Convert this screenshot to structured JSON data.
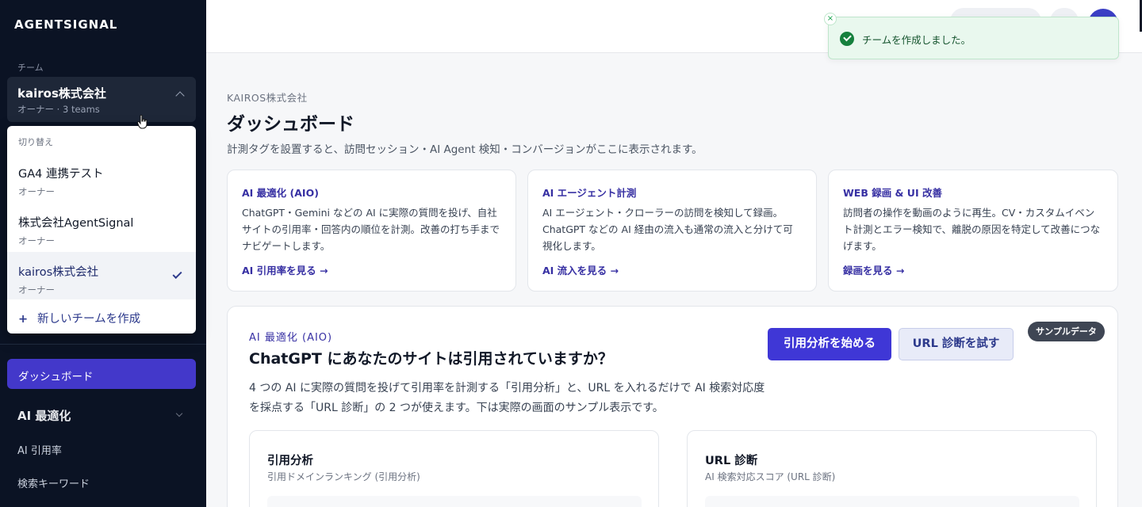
{
  "sidebar": {
    "brand": "AGENTSIGNAL",
    "team_section_label": "チーム",
    "current_team": {
      "name": "kairos株式会社",
      "meta": "オーナー · 3 teams"
    },
    "dropdown": {
      "header": "切り替え",
      "items": [
        {
          "name": "GA4 連携テスト",
          "role": "オーナー",
          "active": false
        },
        {
          "name": "株式会社AgentSignal",
          "role": "オーナー",
          "active": false
        },
        {
          "name": "kairos株式会社",
          "role": "オーナー",
          "active": true
        }
      ],
      "create_plus": "+",
      "create_label": "新しいチームを作成"
    },
    "nav": {
      "dashboard": "ダッシュボード",
      "group": "AI 最適化",
      "sub_items": [
        "AI 引用率",
        "検索キーワード"
      ]
    }
  },
  "toast": {
    "close": "×",
    "message": "チームを作成しました。"
  },
  "main": {
    "breadcrumb": "KAIROS株式会社",
    "title": "ダッシュボード",
    "description": "計測タグを設置すると、訪問セッション・AI Agent 検知・コンバージョンがここに表示されます。",
    "cards": [
      {
        "title": "AI 最適化 (AIO)",
        "body": "ChatGPT・Gemini などの AI に実際の質問を投げ、自社サイトの引用率・回答内の順位を計測。改善の打ち手までナビゲートします。",
        "link": "AI 引用率を見る →"
      },
      {
        "title": "AI エージェント計測",
        "body": "AI エージェント・クローラーの訪問を検知して録画。ChatGPT などの AI 経由の流入も通常の流入と分けて可視化します。",
        "link": "AI 流入を見る →"
      },
      {
        "title": "WEB 録画 & UI 改善",
        "body": "訪問者の操作を動画のように再生。CV・カスタムイベント計測とエラー検知で、離脱の原因を特定して改善につなげます。",
        "link": "録画を見る →"
      }
    ],
    "panel": {
      "kicker": "AI 最適化 (AIO)",
      "title": "ChatGPT にあなたのサイトは引用されていますか？",
      "description": "4 つの AI に実際の質問を投げて引用率を計測する「引用分析」と、URL を入れるだけで AI 検索対応度を採点する「URL 診断」の 2 つが使えます。下は実際の画面のサンプル表示です。",
      "primary_button": "引用分析を始める",
      "secondary_button": "URL 診断を試す",
      "badge": "サンプルデータ",
      "sub_cards": [
        {
          "title": "引用分析",
          "subtitle": "引用ドメインランキング (引用分析)"
        },
        {
          "title": "URL 診断",
          "subtitle": "AI 検索対応スコア (URL 診断)"
        }
      ]
    }
  },
  "colors": {
    "sidebar_bg": "#0b1324",
    "accent": "#4338ca",
    "toast_bg": "#e9f8ee",
    "success": "#15803d"
  },
  "icons": [
    "chevron-up-icon",
    "check-icon",
    "plus-icon",
    "chevron-down-icon",
    "close-icon",
    "success-check-icon",
    "pointer-cursor-icon"
  ]
}
